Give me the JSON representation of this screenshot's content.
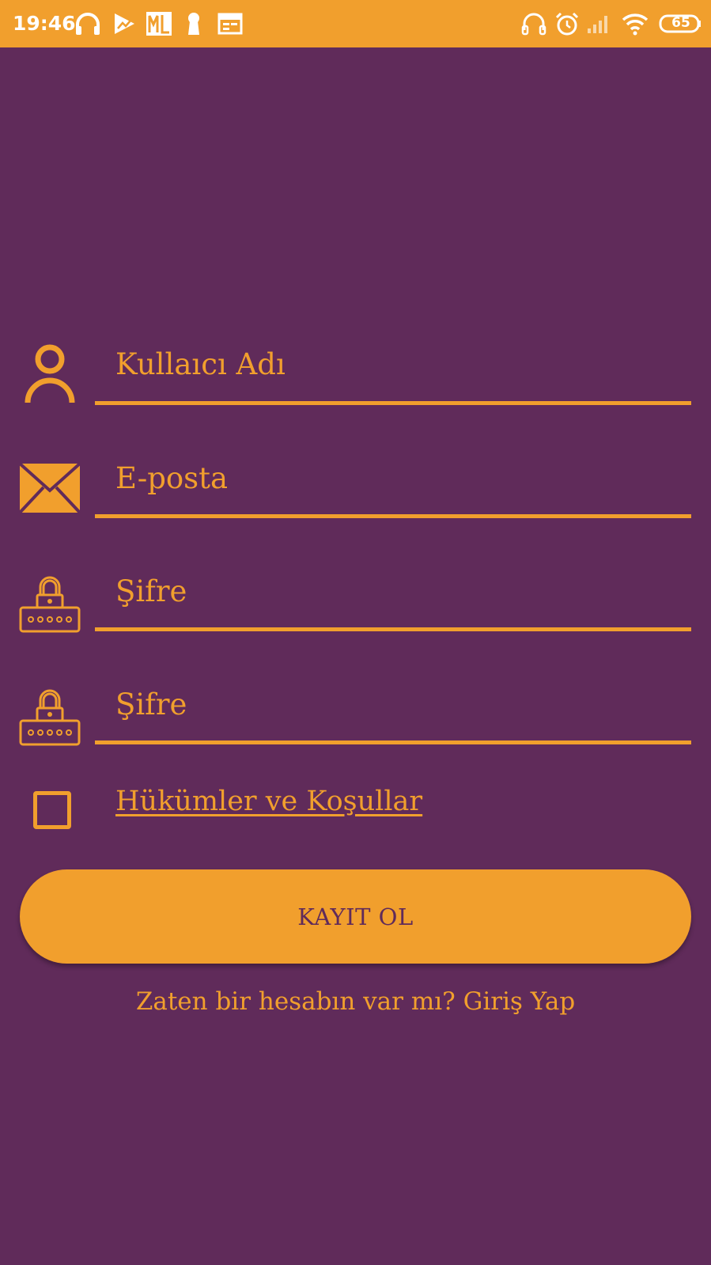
{
  "status_bar": {
    "time": "19:46",
    "battery": "65",
    "colors": {
      "background": "#f19f2d",
      "foreground": "#ffffff"
    },
    "left_icons": [
      "headphones-icon",
      "play-store-icon",
      "ml-app-icon",
      "keyhole-icon",
      "calendar-icon"
    ],
    "right_icons": [
      "headset-icon",
      "alarm-icon",
      "signal-icon",
      "wifi-icon",
      "battery-icon"
    ]
  },
  "form": {
    "username_placeholder": "Kullaıcı Adı",
    "email_placeholder": "E-posta",
    "password_placeholder": "Şifre",
    "password_confirm_placeholder": "Şifre",
    "terms_label": "Hükümler ve Koşullar",
    "terms_checked": false,
    "register_button": "KAYIT OL",
    "login_prompt": "Zaten bir hesabın var mı? Giriş Yap"
  },
  "icons": {
    "username": "user-icon",
    "email": "envelope-icon",
    "password": "padlock-icon",
    "password_confirm": "padlock-icon"
  },
  "colors": {
    "background": "#602b5a",
    "accent": "#f19f2d"
  }
}
